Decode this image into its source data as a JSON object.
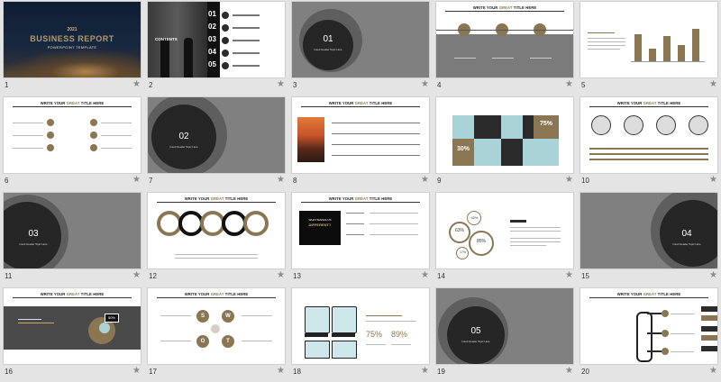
{
  "slides": [
    {
      "num": "1",
      "year": "2021",
      "title": "BUSINESS REPORT",
      "subtitle": "POWERPOINT TEMPLATE"
    },
    {
      "num": "2",
      "contents": "CONTENTS",
      "items": [
        "01",
        "02",
        "03",
        "04",
        "05"
      ]
    },
    {
      "num": "3",
      "section": "01",
      "caption": "Insert Header Topic Here"
    },
    {
      "num": "4",
      "title_a": "WRITE YOUR ",
      "title_b": "GREAT",
      "title_c": " TITLE HERE"
    },
    {
      "num": "5"
    },
    {
      "num": "6",
      "title_a": "WRITE YOUR ",
      "title_b": "GREAT",
      "title_c": " TITLE HERE",
      "labels": [
        "01",
        "02",
        "03",
        "04",
        "05",
        "06"
      ]
    },
    {
      "num": "7",
      "section": "02",
      "caption": "Insert Header Topic Here"
    },
    {
      "num": "8",
      "title_a": "WRITE YOUR ",
      "title_b": "GREAT",
      "title_c": " TITLE HERE"
    },
    {
      "num": "9",
      "title_a": "WRITE YOUR ",
      "title_b": "GREAT",
      "title_c": " TITLE HERE",
      "p1": "75%",
      "p2": "30%"
    },
    {
      "num": "10",
      "title_a": "WRITE YOUR ",
      "title_b": "GREAT",
      "title_c": " TITLE HERE"
    },
    {
      "num": "11",
      "section": "03",
      "caption": "Insert Header Topic Here"
    },
    {
      "num": "12",
      "title_a": "WRITE YOUR ",
      "title_b": "GREAT",
      "title_c": " TITLE HERE"
    },
    {
      "num": "13",
      "title_a": "WRITE YOUR ",
      "title_b": "GREAT",
      "title_c": " TITLE HERE",
      "box_line1": "WHAT MAKES US",
      "box_line2": "DIFFERENT?"
    },
    {
      "num": "14",
      "title_a": "WRITE YOUR ",
      "title_b": "GREAT",
      "title_c": " TITLE HERE",
      "vals": [
        "42%",
        "63%",
        "85%",
        "17%"
      ]
    },
    {
      "num": "15",
      "section": "04",
      "caption": "Insert Header Topic Here"
    },
    {
      "num": "16",
      "title_a": "WRITE YOUR ",
      "title_b": "GREAT",
      "title_c": " TITLE HERE",
      "badge": "50%"
    },
    {
      "num": "17",
      "title_a": "WRITE YOUR ",
      "title_b": "GREAT",
      "title_c": " TITLE HERE",
      "swot": [
        "S",
        "W",
        "O",
        "T"
      ]
    },
    {
      "num": "18",
      "title_a": "WRITE YOUR ",
      "title_b": "GREAT",
      "title_c": " TITLE HERE",
      "v1": "75%",
      "v2": "89%"
    },
    {
      "num": "19",
      "section": "05",
      "caption": "Insert Header Topic Here"
    },
    {
      "num": "20",
      "title_a": "WRITE YOUR ",
      "title_b": "GREAT",
      "title_c": " TITLE HERE"
    }
  ],
  "colors": {
    "accent": "#8b7653",
    "dark": "#2b2b2b",
    "grey": "#7b7b7b",
    "teal": "#a9d3d6"
  },
  "icons": {
    "star": "★"
  }
}
